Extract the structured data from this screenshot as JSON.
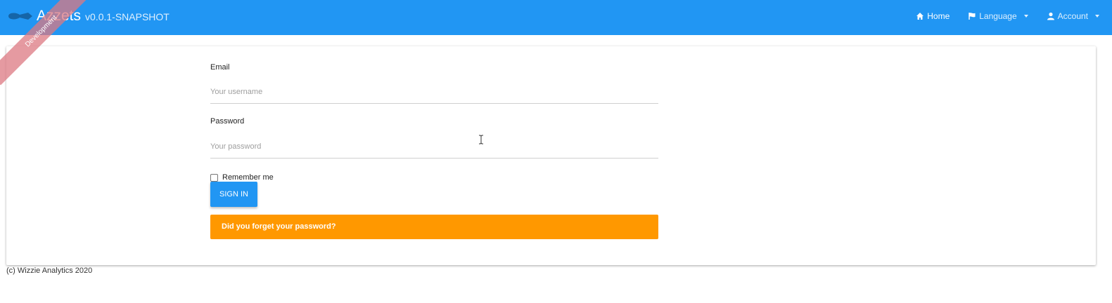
{
  "navbar": {
    "brand_name": "Azzets",
    "brand_version": "v0.0.1-SNAPSHOT",
    "ribbon": "Development",
    "items": [
      {
        "label": "Home",
        "icon": "home-icon"
      },
      {
        "label": "Language",
        "icon": "flag-icon"
      },
      {
        "label": "Account",
        "icon": "user-icon"
      }
    ]
  },
  "login": {
    "email_label": "Email",
    "email_placeholder": "Your username",
    "password_label": "Password",
    "password_placeholder": "Your password",
    "remember_label": "Remember me",
    "signin_label": "SIGN IN",
    "forgot_label": "Did you forget your password?"
  },
  "footer": {
    "text": "(c) Wizzie Analytics 2020"
  },
  "colors": {
    "primary": "#2196f3",
    "warning": "#ff9800",
    "ribbon": "#dc7882"
  }
}
